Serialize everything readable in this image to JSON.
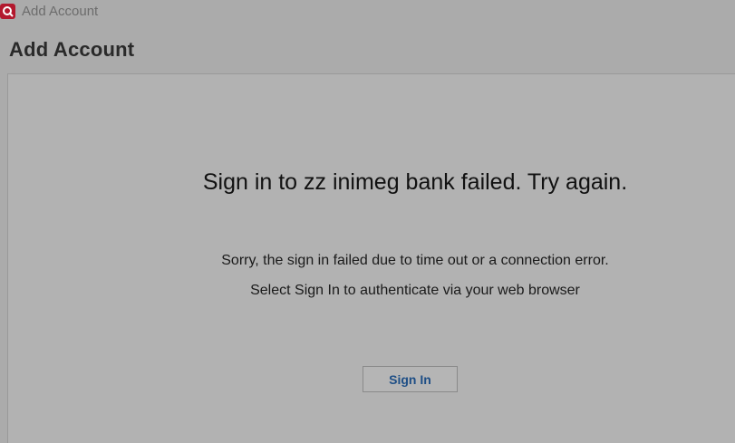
{
  "window": {
    "title": "Add Account",
    "icon": "app-logo-icon"
  },
  "page": {
    "title": "Add Account"
  },
  "error": {
    "heading": "Sign in to zz inimeg bank failed. Try again.",
    "message_line_1": "Sorry, the sign in failed due to time out or a connection error.",
    "message_line_2": "Select Sign In to authenticate via your web browser"
  },
  "actions": {
    "sign_in_label": "Sign In"
  },
  "colors": {
    "brand": "#b3192e",
    "link_text": "#1f4f86",
    "background": "#ababab"
  }
}
